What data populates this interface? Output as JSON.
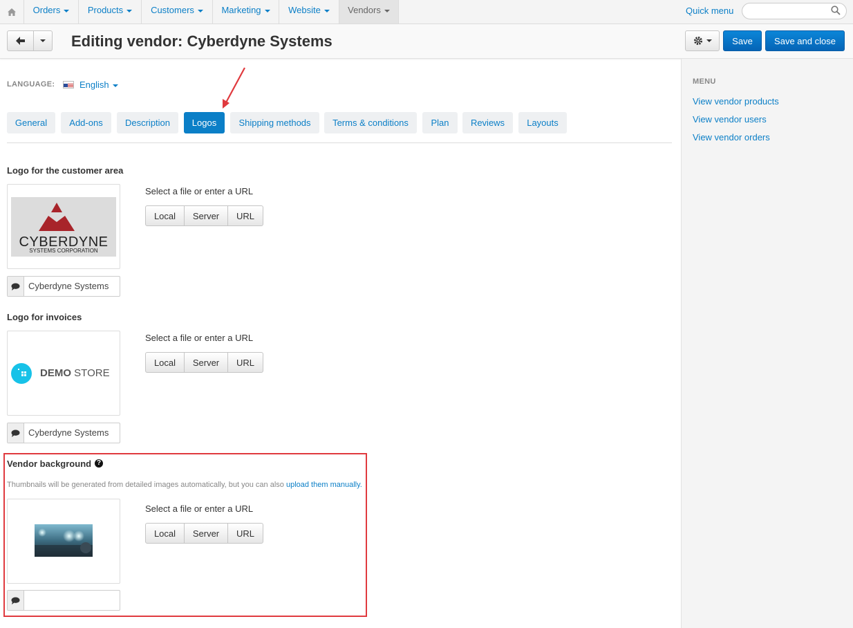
{
  "topnav": {
    "items": [
      {
        "label": "Orders"
      },
      {
        "label": "Products"
      },
      {
        "label": "Customers"
      },
      {
        "label": "Marketing"
      },
      {
        "label": "Website"
      },
      {
        "label": "Vendors"
      }
    ],
    "quick_menu": "Quick menu",
    "search_placeholder": ""
  },
  "header": {
    "title": "Editing vendor: Cyberdyne Systems",
    "save": "Save",
    "save_close": "Save and close"
  },
  "language": {
    "label": "LANGUAGE:",
    "value": "English"
  },
  "tabs": [
    {
      "label": "General"
    },
    {
      "label": "Add-ons"
    },
    {
      "label": "Description"
    },
    {
      "label": "Logos",
      "active": true
    },
    {
      "label": "Shipping methods"
    },
    {
      "label": "Terms & conditions"
    },
    {
      "label": "Plan"
    },
    {
      "label": "Reviews"
    },
    {
      "label": "Layouts"
    }
  ],
  "sections": {
    "customer_logo": {
      "title": "Logo for the customer area",
      "logo_text_main": "CYBERDYNE",
      "logo_text_sub": "SYSTEMS CORPORATION",
      "alt_text": "Cyberdyne Systems"
    },
    "invoice_logo": {
      "title": "Logo for invoices",
      "logo_text_bold": "DEMO",
      "logo_text_light": "STORE",
      "alt_text": "Cyberdyne Systems"
    },
    "background": {
      "title": "Vendor background",
      "hint": "Thumbnails will be generated from detailed images automatically, but you can also",
      "hint_link": "upload them manually.",
      "alt_text": ""
    }
  },
  "uploader": {
    "select_label": "Select a file or enter a URL",
    "local": "Local",
    "server": "Server",
    "url": "URL"
  },
  "sidebar": {
    "title": "MENU",
    "links": [
      {
        "label": "View vendor products"
      },
      {
        "label": "View vendor users"
      },
      {
        "label": "View vendor orders"
      }
    ]
  },
  "colors": {
    "accent": "#0b7fc7",
    "highlight_border": "#e0393e",
    "cyberdyne_red": "#a8242a"
  }
}
